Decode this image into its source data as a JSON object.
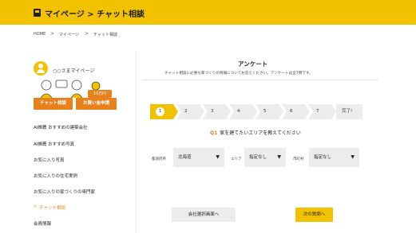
{
  "header": {
    "title": "マイページ > チャット相談",
    "icon": "profile-card-icon"
  },
  "breadcrumb": {
    "items": [
      "HOME",
      "マイページ",
      "チャット相談"
    ],
    "separator": ">"
  },
  "sidebar": {
    "username": "○○さまマイページ",
    "chat_button": "チャット相談",
    "estimate_button": "お買い金申請",
    "badge": "10万円",
    "items": [
      "AI推薦 おすすめの建築会社",
      "AI推薦 おすすめ写真",
      "お気に入り写真",
      "お気に入りの住宅実例",
      "お気に入りの家づくりの専門家",
      "チャット相談",
      "会員情報"
    ],
    "active_marker": ">"
  },
  "survey": {
    "title": "アンケート",
    "subtitle": "チャット相談に必要な家づくりの情報についてお答えください。アンケートは全7問です。",
    "steps": [
      "1",
      "2",
      "3",
      "4",
      "5",
      "6",
      "7",
      "完了!"
    ],
    "question_number": "Q1",
    "question_text": "家を建てたいエリアを教えてください",
    "fields": [
      {
        "label": "都道府県",
        "value": "北海道"
      },
      {
        "label": "エリア",
        "value": "指定なし"
      },
      {
        "label": "市町村",
        "value": "指定なし"
      }
    ],
    "arrow": "▼",
    "back_button": "会社選択画面へ",
    "next_button": "次の質問へ"
  },
  "colors": {
    "accent_yellow": "#f2c200",
    "accent_orange": "#e8801c",
    "panel_gray": "#ececec"
  }
}
